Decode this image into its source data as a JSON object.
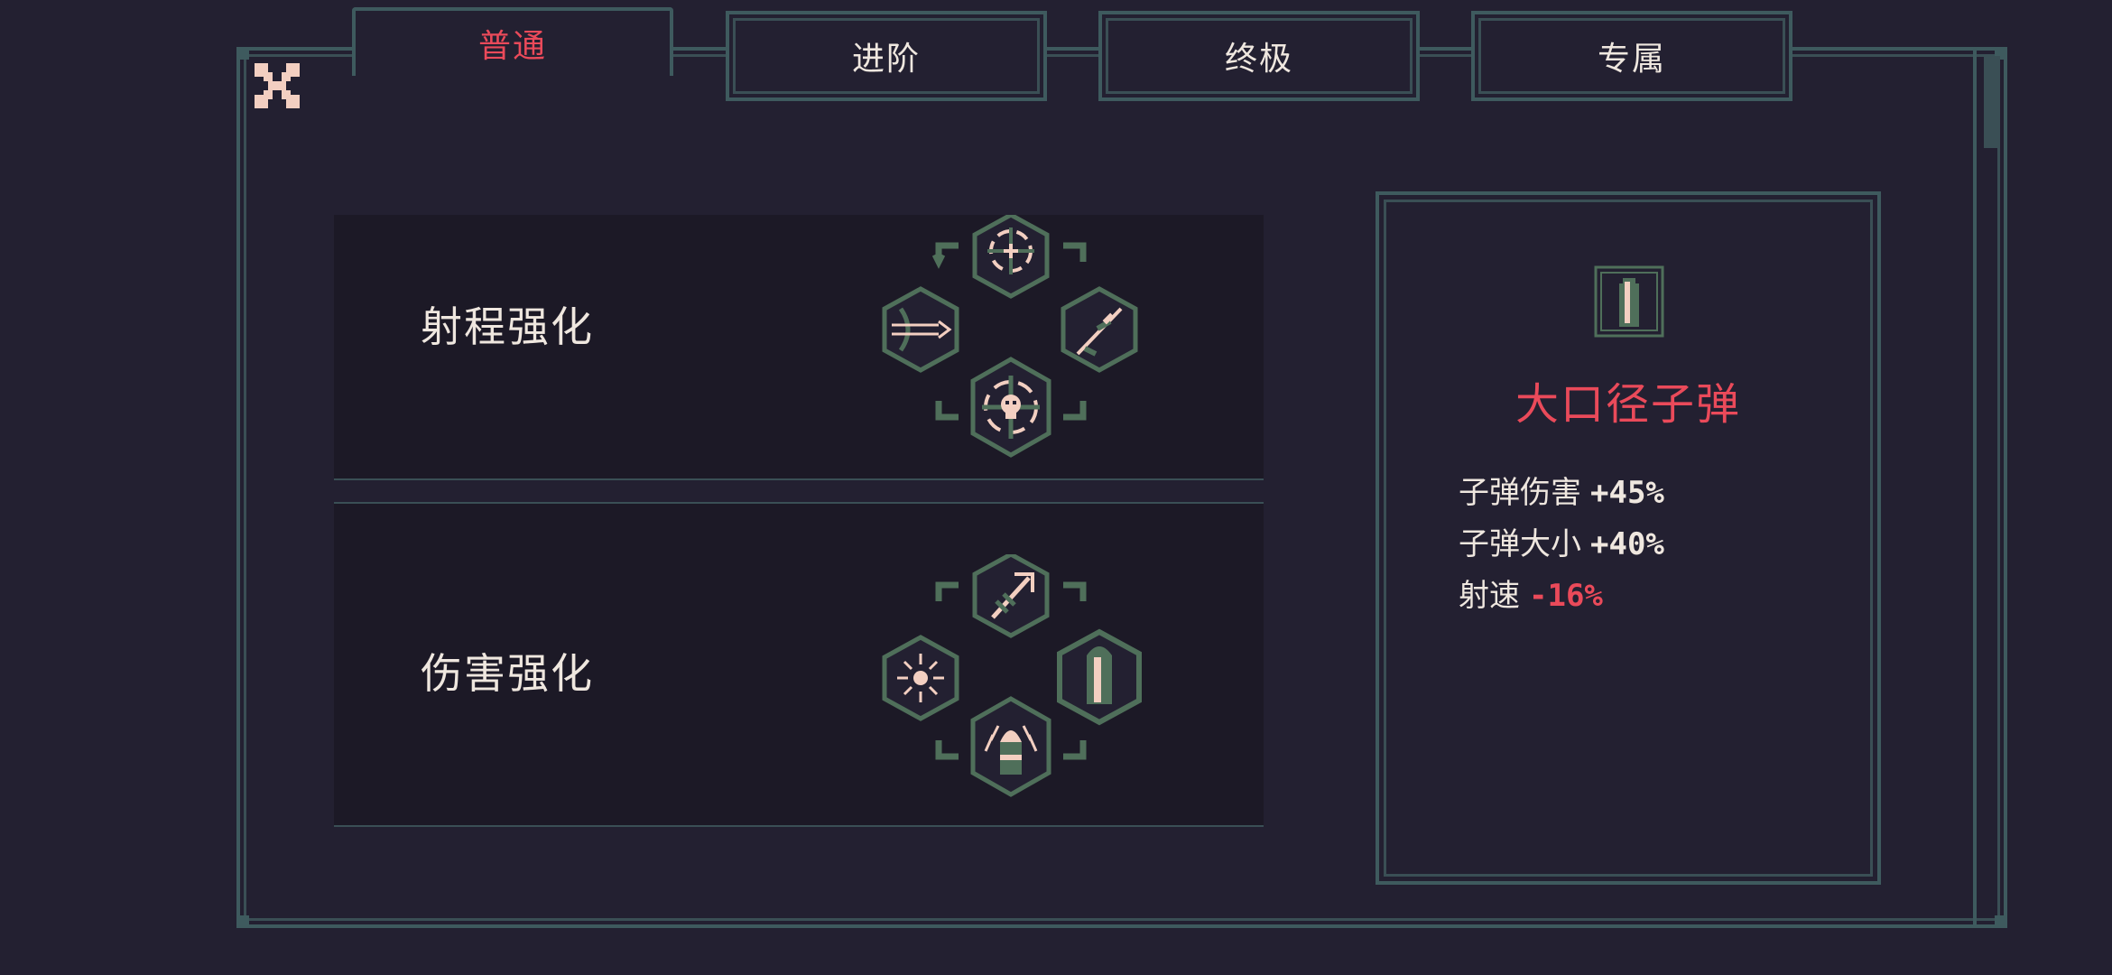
{
  "tabs": [
    {
      "label": "普通",
      "active": true
    },
    {
      "label": "进阶",
      "active": false
    },
    {
      "label": "终极",
      "active": false
    },
    {
      "label": "专属",
      "active": false
    }
  ],
  "categories": [
    {
      "title": "射程强化",
      "icons": [
        "crosshair-icon",
        "piercing-arrow-icon",
        "sniper-rifle-icon",
        "skull-target-icon"
      ]
    },
    {
      "title": "伤害强化",
      "icons": [
        "rocket-arrow-icon",
        "spark-burst-icon",
        "large-bullet-icon",
        "grenade-icon"
      ]
    }
  ],
  "detail": {
    "icon": "bullet-icon",
    "title": "大口径子弹",
    "stats": [
      {
        "label": "子弹伤害",
        "value": "+45%",
        "type": "positive"
      },
      {
        "label": "子弹大小",
        "value": "+40%",
        "type": "positive"
      },
      {
        "label": "射速",
        "value": "-16%",
        "type": "negative"
      }
    ]
  },
  "colors": {
    "background": "#232031",
    "border": "#3e5a5e",
    "icon_green": "#4f6f5a",
    "accent_red": "#ea4a5a",
    "text": "#efe7df"
  }
}
